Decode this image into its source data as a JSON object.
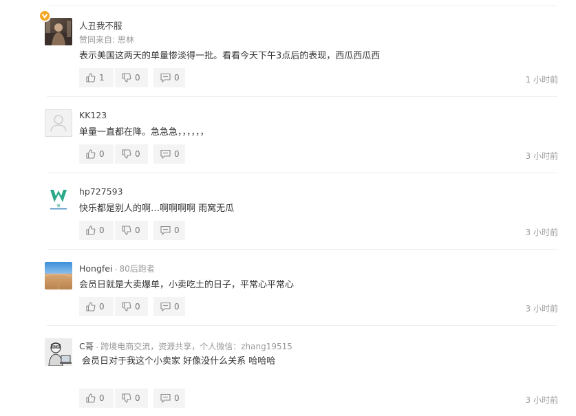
{
  "comments": [
    {
      "username": "人丑我不服",
      "title": "",
      "agree_prefix": "赞同来自:",
      "agree_name": "思林",
      "text": "表示美国这两天的单量惨淡得一批。看看今天下午3点后的表现，西瓜西瓜西",
      "likes": "1",
      "dislikes": "0",
      "replies": "0",
      "time": "1 小时前",
      "avatar": "photo-avatar",
      "verified": true
    },
    {
      "username": "KK123",
      "title": "",
      "text": "单量一直都在降。急急急，，，，，，",
      "likes": "0",
      "dislikes": "0",
      "replies": "0",
      "time": "3 小时前",
      "avatar": "default-user-avatar"
    },
    {
      "username": "hp727593",
      "title": "",
      "text": "快乐都是别人的啊…啊啊啊啊 雨窝无瓜",
      "likes": "0",
      "dislikes": "0",
      "replies": "0",
      "time": "3 小时前",
      "avatar": "w-logo-avatar",
      "logo_text": "微"
    },
    {
      "username": "Hongfei",
      "separator": "-",
      "title": "80后跑者",
      "text": "会员日就是大卖爆单，小卖吃土的日子，平常心平常心",
      "likes": "0",
      "dislikes": "0",
      "replies": "0",
      "time": "3 小时前",
      "avatar": "desert-avatar"
    },
    {
      "username": "C哥",
      "separator": "-",
      "title": "跨境电商交流，资源共享，个人微信：zhang19515",
      "text": "会员日对于我这个小卖家 好像没什么关系 哈哈哈",
      "likes": "0",
      "dislikes": "0",
      "replies": "0",
      "time": "3 小时前",
      "avatar": "cartoon-avatar"
    }
  ],
  "colors": {
    "badge": "#f5a623",
    "button_bg": "#f4f4f4",
    "muted": "#999999"
  },
  "icons": {
    "like": "thumbs-up-icon",
    "dislike": "thumbs-down-icon",
    "reply": "comment-icon"
  }
}
